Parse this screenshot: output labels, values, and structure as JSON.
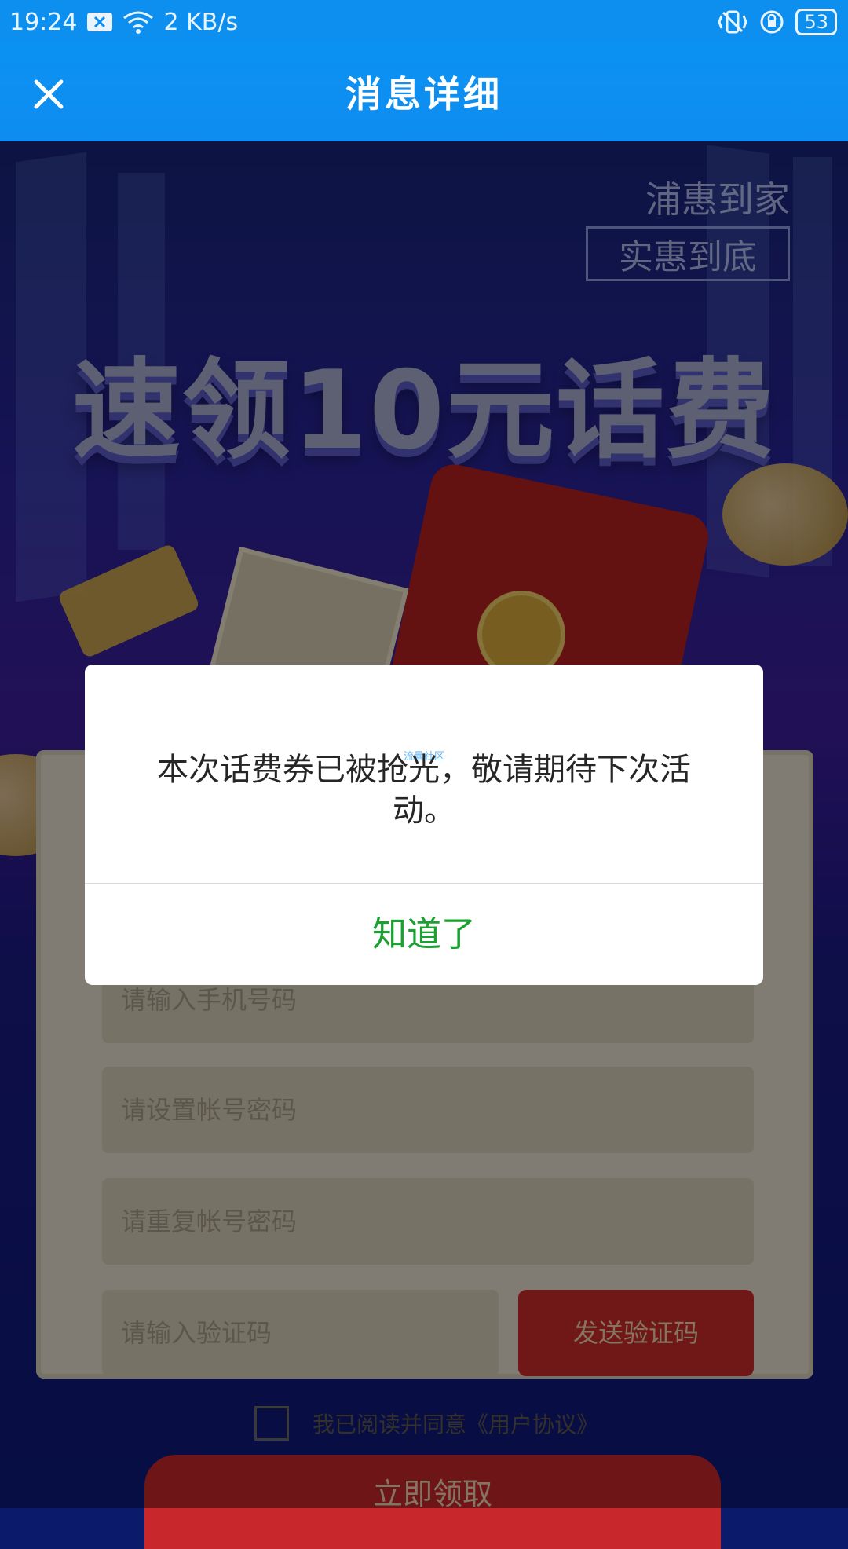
{
  "status_bar": {
    "time": "19:24",
    "network_speed": "2 KB/s",
    "battery": "53",
    "icons": [
      "notification-x-icon",
      "wifi-icon",
      "vibrate-icon",
      "rotation-lock-icon",
      "battery-icon"
    ]
  },
  "header": {
    "title": "消息详细",
    "close_icon": "close-icon"
  },
  "promo": {
    "brand_line1": "浦惠到家",
    "brand_line2": "实惠到底",
    "headline": "速领10元话费"
  },
  "form": {
    "phone_placeholder": "请输入手机号码",
    "password_placeholder": "请设置帐号密码",
    "confirm_password_placeholder": "请重复帐号密码",
    "code_placeholder": "请输入验证码",
    "send_code_label": "发送验证码",
    "agreement_text": "我已阅读并同意《用户协议》",
    "claim_label": "立即领取"
  },
  "dialog": {
    "message": "本次话费券已被抢光，敬请期待下次活动。",
    "watermark": "流量社区",
    "ok_label": "知道了"
  },
  "colors": {
    "header_blue": "#0d8fef",
    "ok_green": "#1aa131",
    "promo_red": "#cc2a2a"
  }
}
